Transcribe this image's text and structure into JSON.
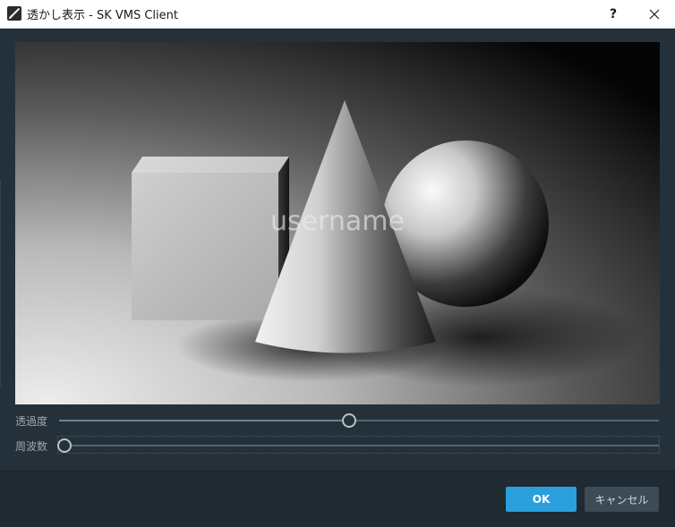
{
  "window": {
    "title": "透かし表示 - SK VMS Client",
    "help_label": "?",
    "close_label": "✕"
  },
  "preview": {
    "watermark_text": "username",
    "image_description_icon": "geometric-shapes-image"
  },
  "sliders": {
    "opacity": {
      "label": "透過度",
      "value_fraction": 0.475
    },
    "frequency": {
      "label": "周波数",
      "value_fraction": 0.0
    }
  },
  "footer": {
    "ok_label": "OK",
    "cancel_label": "キャンセル"
  },
  "colors": {
    "accent": "#2a9fdc",
    "background": "#25313a",
    "footer_bg": "#1f2a33"
  }
}
